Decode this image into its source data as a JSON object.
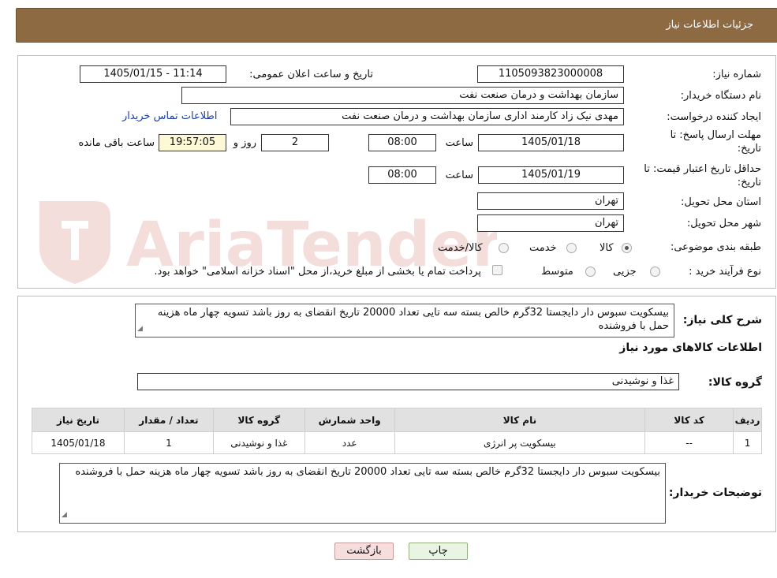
{
  "header": {
    "title": "جزئیات اطلاعات نیاز"
  },
  "watermark": {
    "text": "AriaTender.neT",
    "color": "#c0392b"
  },
  "form": {
    "need_number": {
      "label": "شماره نیاز:",
      "value": "1105093823000008"
    },
    "announce": {
      "label": "تاریخ و ساعت اعلان عمومی:",
      "value": "1405/01/15 - 11:14"
    },
    "buyer_org": {
      "label": "نام دستگاه خریدار:",
      "value": "سازمان بهداشت و درمان صنعت نفت"
    },
    "requester": {
      "label": "ایجاد کننده درخواست:",
      "value": "مهدی نیک زاد کارمند اداری سازمان بهداشت و درمان صنعت نفت",
      "contact_link": "اطلاعات تماس خریدار"
    },
    "reply_deadline": {
      "label": "مهلت ارسال پاسخ: تا تاریخ:",
      "date": "1405/01/18",
      "time_label": "ساعت",
      "time": "08:00",
      "days": "2",
      "days_label": "روز و",
      "remaining": "19:57:05",
      "remaining_label": "ساعت باقی مانده"
    },
    "price_validity": {
      "label": "حداقل تاریخ اعتبار قیمت: تا تاریخ:",
      "date": "1405/01/19",
      "time_label": "ساعت",
      "time": "08:00"
    },
    "province": {
      "label": "استان محل تحویل:",
      "value": "تهران"
    },
    "city": {
      "label": "شهر محل تحویل:",
      "value": "تهران"
    },
    "category": {
      "label": "طبقه بندی موضوعی:",
      "options": [
        "کالا",
        "خدمت",
        "کالا/خدمت"
      ],
      "selected": "کالا"
    },
    "process": {
      "label": "نوع فرآیند خرید :",
      "options": [
        "جزیی",
        "متوسط"
      ],
      "selected": "",
      "payment_note": "پرداخت تمام یا بخشی از مبلغ خرید،از محل \"اسناد خزانه اسلامی\" خواهد بود."
    }
  },
  "summary": {
    "label": "شرح کلی نیاز:",
    "text": "بیسکویت سبوس دار دایجستا 32گرم خالص بسته سه تایی تعداد 20000 تاریخ انقضای به روز باشد  تسویه چهار ماه هزینه حمل با فروشنده"
  },
  "items_section": {
    "title": "اطلاعات کالاهای مورد نیاز",
    "group_label": "گروه کالا:",
    "group_value": "غذا و نوشیدنی",
    "columns": [
      "ردیف",
      "کد کالا",
      "نام کالا",
      "واحد شمارش",
      "گروه کالا",
      "تعداد / مقدار",
      "تاریخ نیاز"
    ],
    "rows": [
      [
        "1",
        "--",
        "بیسکویت پر انرژی",
        "عدد",
        "غذا و نوشیدنی",
        "1",
        "1405/01/18"
      ]
    ]
  },
  "buyer_notes": {
    "label": "توضیحات خریدار:",
    "text": "بیسکویت سبوس دار دایجستا 32گرم خالص بسته سه تایی تعداد 20000 تاریخ انقضای به روز باشد  تسویه چهار ماه هزینه حمل با فروشنده"
  },
  "buttons": {
    "print": "چاپ",
    "back": "بازگشت"
  }
}
